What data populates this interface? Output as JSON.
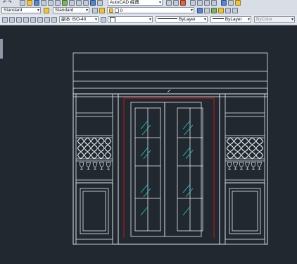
{
  "toolbar_top": {
    "workspace_title": "AutoCAD 经典",
    "undo_redo": "↶ ↷"
  },
  "toolbar_styles": {
    "text_style": "Standard",
    "dim_style": "Standard"
  },
  "toolbar_properties": {
    "layer_value": "0",
    "annotation_scale": "副本 ISO-40",
    "linetype": "ByLayer",
    "lineweight": "ByLayer",
    "plot_style": "ByColor"
  },
  "colors": {
    "canvas_bg": "#212830",
    "lines": "#e8ecf0",
    "glass_accent": "#27c4c9",
    "frame_red": "#c0181c"
  },
  "icons": [
    "new-file-icon",
    "open-icon",
    "save-icon",
    "print-icon",
    "zoom-icon",
    "pan-icon",
    "layer-icon",
    "properties-icon",
    "match-icon",
    "help-icon"
  ]
}
